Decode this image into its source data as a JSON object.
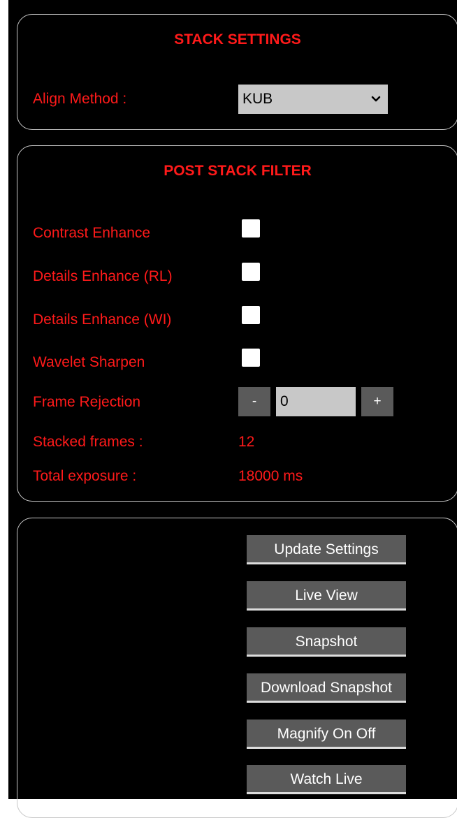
{
  "stack_settings": {
    "title": "STACK SETTINGS",
    "align_method": {
      "label": "Align Method :",
      "selected": "KUB"
    }
  },
  "post_stack_filter": {
    "title": "POST STACK FILTER",
    "options": [
      {
        "label": "Contrast Enhance",
        "checked": false
      },
      {
        "label": "Details Enhance (RL)",
        "checked": false
      },
      {
        "label": "Details Enhance (WI)",
        "checked": false
      },
      {
        "label": "Wavelet Sharpen",
        "checked": false
      }
    ],
    "frame_rejection": {
      "label": "Frame Rejection",
      "minus": "-",
      "value": "0",
      "plus": "+"
    },
    "stacked_frames": {
      "label": "Stacked frames :",
      "value": "12"
    },
    "total_exposure": {
      "label": "Total exposure :",
      "value": "18000 ms"
    }
  },
  "actions": {
    "update_settings": "Update Settings",
    "live_view": "Live View",
    "snapshot": "Snapshot",
    "download_snapshot": "Download Snapshot",
    "magnify": "Magnify On Off",
    "watch_live": "Watch Live"
  },
  "colors": {
    "background": "#000000",
    "text": "#ff1a1a",
    "button": "#5a5a5a",
    "input": "#c8c8c8",
    "border": "#c8c8c8"
  }
}
